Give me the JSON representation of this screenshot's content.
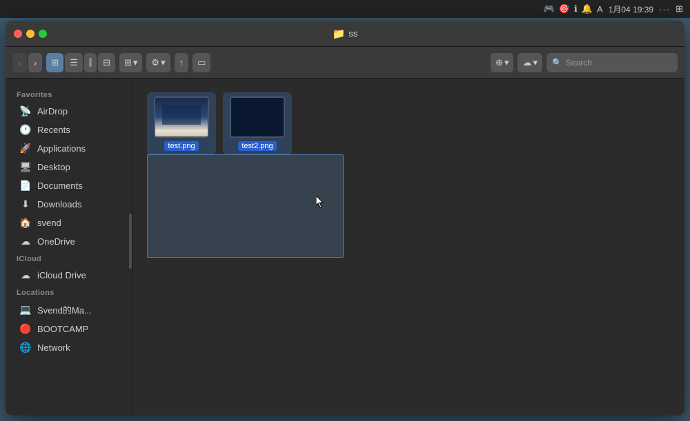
{
  "menubar": {
    "time": "1月04 19:39",
    "dots": "···",
    "grid_icon": "⊞"
  },
  "window": {
    "title": "ss",
    "traffic_lights": {
      "close": "close",
      "minimize": "minimize",
      "maximize": "maximize"
    }
  },
  "toolbar": {
    "back_label": "‹",
    "forward_label": "›",
    "view_icon": "⊞",
    "list_icon": "☰",
    "column_icon": "⫿",
    "gallery_icon": "⊟",
    "sort_label": "⊞ ▾",
    "action_label": "⚙ ▾",
    "share_label": "↑",
    "tags_label": "▭",
    "action2_label": "⊕ ▾",
    "location_label": "⊕ ▾",
    "search_placeholder": "Search"
  },
  "sidebar": {
    "favorites_label": "Favorites",
    "items_favorites": [
      {
        "id": "airdrop",
        "icon": "📡",
        "label": "AirDrop"
      },
      {
        "id": "recents",
        "icon": "🕐",
        "label": "Recents"
      },
      {
        "id": "applications",
        "icon": "🚀",
        "label": "Applications"
      },
      {
        "id": "desktop",
        "icon": "🖥",
        "label": "Desktop"
      },
      {
        "id": "documents",
        "icon": "📄",
        "label": "Documents"
      },
      {
        "id": "downloads",
        "icon": "⬇",
        "label": "Downloads"
      },
      {
        "id": "svend",
        "icon": "🏠",
        "label": "svend"
      },
      {
        "id": "onedrive",
        "icon": "☁",
        "label": "OneDrive"
      }
    ],
    "icloud_label": "iCloud",
    "items_icloud": [
      {
        "id": "icloud-drive",
        "icon": "☁",
        "label": "iCloud Drive"
      }
    ],
    "locations_label": "Locations",
    "items_locations": [
      {
        "id": "svend-mac",
        "icon": "💻",
        "label": "Svend的Ma..."
      },
      {
        "id": "bootcamp",
        "icon": "🔴",
        "label": "BOOTCAMP"
      },
      {
        "id": "network",
        "icon": "🌐",
        "label": "Network"
      }
    ]
  },
  "files": [
    {
      "id": "test1",
      "name": "test.png",
      "thumb": "test1",
      "selected": true
    },
    {
      "id": "test2",
      "name": "test2.png",
      "thumb": "test2",
      "selected": true
    }
  ]
}
